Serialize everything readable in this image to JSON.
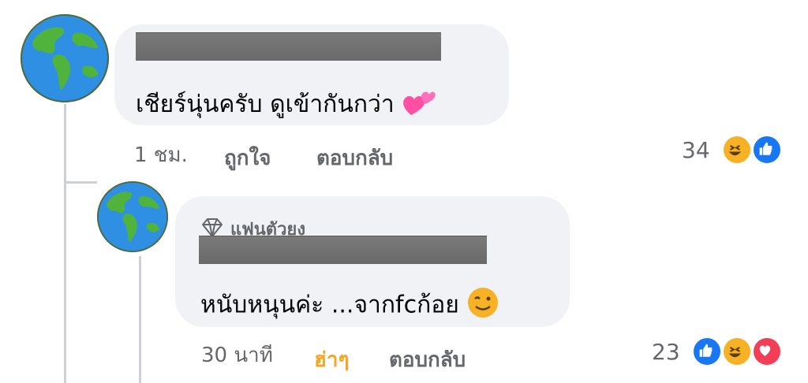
{
  "comment": {
    "text": "เชียร์นุ่นครับ ดูเข้ากันกว่า",
    "emoji_icon": "two-hearts-icon",
    "time": "1 ชม.",
    "like_label": "ถูกใจ",
    "reply_label": "ตอบกลับ",
    "reaction_count": "34",
    "reactions": [
      "haha-icon",
      "like-icon"
    ]
  },
  "reply": {
    "badge_label": "แฟนตัวยง",
    "badge_icon": "diamond-icon",
    "text": "หนับหนุนค่ะ ...จากfcก้อย",
    "emoji_icon": "winking-face-icon",
    "time": "30 นาที",
    "haha_label": "ฮ่าๆ",
    "reply_label": "ตอบกลับ",
    "reaction_count": "23",
    "reactions": [
      "like-icon",
      "haha-icon",
      "love-icon"
    ]
  },
  "colors": {
    "bubble": "#f0f2f5",
    "meta": "#65676b",
    "haha_active": "#f5a623",
    "like_blue": "#1877f2",
    "love_red": "#f33e58",
    "haha_yellow": "#f7b125"
  }
}
